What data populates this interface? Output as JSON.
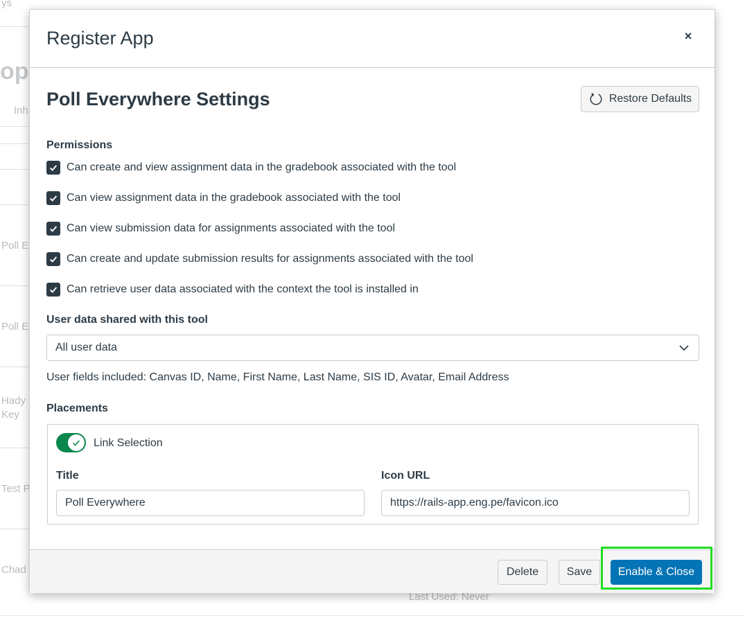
{
  "background": {
    "top_text": "ys",
    "big_text": "op",
    "col_text": "Inh",
    "rows": [
      "Poll E",
      "Poll E",
      "Hady",
      "Key",
      "Test P",
      "Chad"
    ],
    "last_used": "Last Used: Never"
  },
  "modal": {
    "title": "Register App",
    "close_glyph": "×"
  },
  "settings": {
    "title": "Poll Everywhere Settings",
    "restore_label": "Restore Defaults"
  },
  "permissions": {
    "label": "Permissions",
    "items": [
      {
        "label": "Can create and view assignment data in the gradebook associated with the tool",
        "checked": true
      },
      {
        "label": "Can view assignment data in the gradebook associated with the tool",
        "checked": true
      },
      {
        "label": "Can view submission data for assignments associated with the tool",
        "checked": true
      },
      {
        "label": "Can create and update submission results for assignments associated with the tool",
        "checked": true
      },
      {
        "label": "Can retrieve user data associated with the context the tool is installed in",
        "checked": true
      }
    ]
  },
  "user_data": {
    "label": "User data shared with this tool",
    "selected": "All user data",
    "fields_text": "User fields included: Canvas ID, Name, First Name, Last Name, SIS ID, Avatar, Email Address"
  },
  "placements": {
    "label": "Placements",
    "link_selection_label": "Link Selection",
    "enabled": true,
    "title_label": "Title",
    "title_value": "Poll Everywhere",
    "icon_url_label": "Icon URL",
    "icon_url_value": "https://rails-app.eng.pe/favicon.ico"
  },
  "footer": {
    "delete_label": "Delete",
    "save_label": "Save",
    "enable_close_label": "Enable & Close"
  },
  "colors": {
    "primary": "#0374b5",
    "toggle_on": "#0b874b",
    "text": "#2d3b45",
    "highlight": "#22dd22"
  }
}
